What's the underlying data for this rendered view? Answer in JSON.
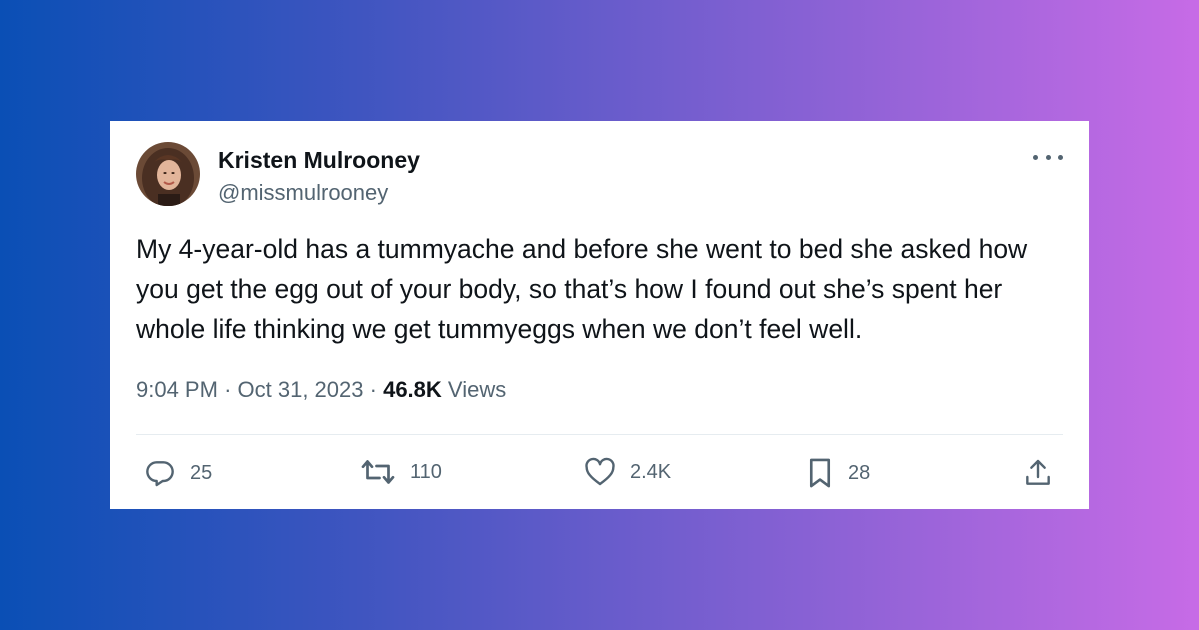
{
  "tweet": {
    "author_name": "Kristen Mulrooney",
    "handle": "@missmulrooney",
    "text": "My 4-year-old has a tummyache and before she went to bed she asked how you get the egg out of your body, so that’s how I found out she’s spent her whole life thinking we get tummyeggs when we don’t feel well.",
    "time": "9:04 PM",
    "date": "Oct 31, 2023",
    "separator": "·",
    "views_count": "46.8K",
    "views_label": "Views"
  },
  "actions": {
    "reply": {
      "icon": "reply-icon",
      "count": "25"
    },
    "retweet": {
      "icon": "retweet-icon",
      "count": "110"
    },
    "like": {
      "icon": "heart-icon",
      "count": "2.4K"
    },
    "bookmark": {
      "icon": "bookmark-icon",
      "count": "28"
    },
    "share": {
      "icon": "share-icon"
    }
  },
  "colors": {
    "text": "#0f1419",
    "secondary": "#536471",
    "background_gradient_start": "#0a4fb5",
    "background_gradient_end": "#c76be6"
  }
}
